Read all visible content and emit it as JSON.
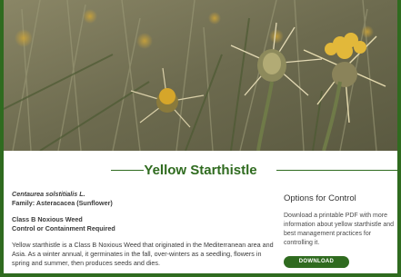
{
  "page": {
    "title": "Yellow Starthistle"
  },
  "hero": {
    "image_subject": "yellow starthistle flowers and spiny seed heads"
  },
  "species": {
    "scientific_name": "Centaurea solstitialis L.",
    "family": "Family: Asteracacea (Sunflower)",
    "class": "Class B Noxious Weed",
    "requirement": "Control or Containment Required",
    "description": "Yellow starthistle is a Class B Noxious Weed that originated in the Mediterranean area and Asia. As a winter annual, it germinates in the fall, over-winters as a seedling, flowers in spring and summer, then produces seeds and dies."
  },
  "options": {
    "heading": "Options for Control",
    "text": "Download a printable PDF with more information about yellow starthistle and best management practices for controlling it.",
    "download_label": "DOWNLOAD"
  },
  "colors": {
    "brand_green": "#2f6b1f",
    "text": "#3a3a3a"
  }
}
